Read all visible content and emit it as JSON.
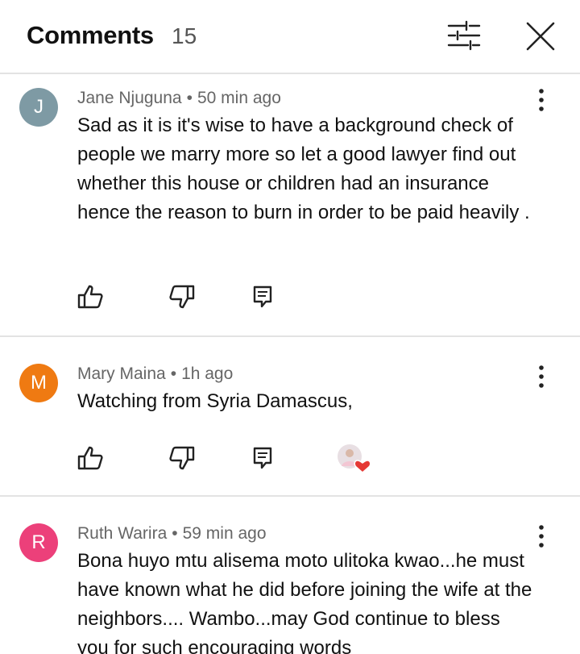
{
  "header": {
    "title": "Comments",
    "count": "15"
  },
  "comments": [
    {
      "initial": "J",
      "author": "Jane Njuguna",
      "time": "50 min ago",
      "text": "Sad as it is it's wise to have a background check of people we marry more so let a good lawyer find out whether this house or children had an insurance hence the reason to burn in order to be paid heavily .",
      "avatar_color": "#7e9aa4"
    },
    {
      "initial": "M",
      "author": "Mary Maina",
      "time": "1h ago",
      "text": "Watching from Syria Damascus,",
      "avatar_color": "#ef7a12",
      "reaction": "heart"
    },
    {
      "initial": "R",
      "author": "Ruth Warira",
      "time": "59 min ago",
      "text": "Bona huyo mtu alisema moto ulitoka kwao...he must have known what he did before joining the wife at the neighbors.... Wambo...may God continue to bless you for such encouraging words",
      "avatar_color": "#ec407a"
    }
  ],
  "icons": {
    "filter": "sliders-icon",
    "close": "close-icon",
    "more": "more-vertical-icon",
    "like": "thumbs-up-icon",
    "dislike": "thumbs-down-icon",
    "reply": "reply-icon",
    "reaction_heart": "heart-icon"
  },
  "meta_separator": "•"
}
